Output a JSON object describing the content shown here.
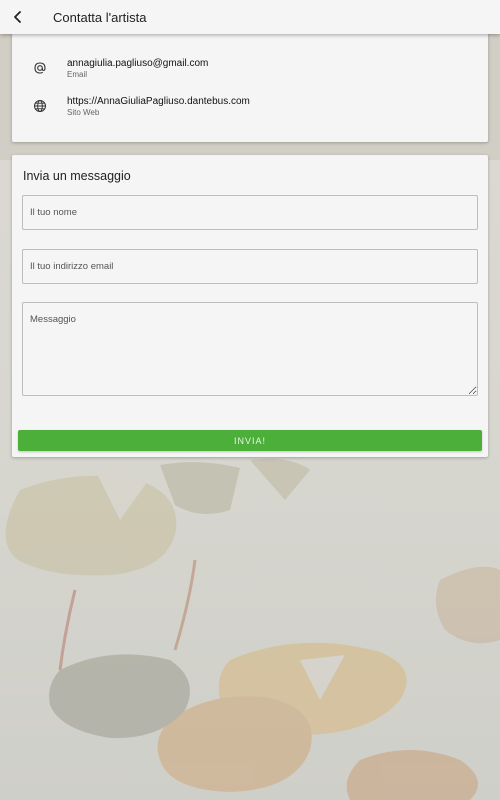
{
  "app_bar": {
    "title": "Contatta l'artista",
    "back_icon": "chevron-left-icon"
  },
  "contacts": [
    {
      "icon": "at-icon",
      "value": "annagiulia.pagliuso@gmail.com",
      "label": "Email"
    },
    {
      "icon": "globe-icon",
      "value": "https://AnnaGiuliaPagliuso.dantebus.com",
      "label": "Sito Web"
    }
  ],
  "form": {
    "title": "Invia un messaggio",
    "name_placeholder": "Il tuo nome",
    "email_placeholder": "Il tuo indirizzo email",
    "message_placeholder": "Messaggio",
    "submit_label": "INVIA!"
  },
  "colors": {
    "accent": "#4caf3a",
    "surface": "#f5f5f5"
  }
}
